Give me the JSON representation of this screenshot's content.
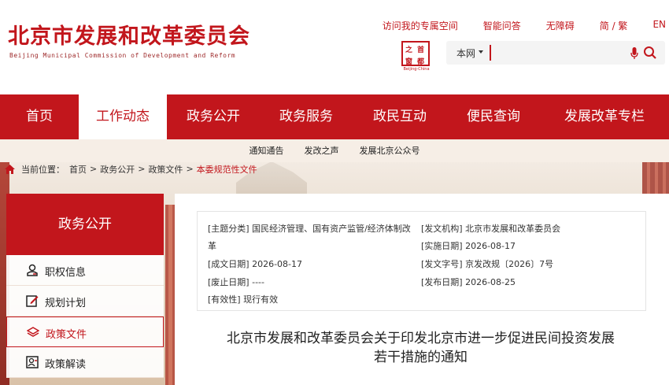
{
  "header": {
    "site_title": "北京市发展和改革委员会",
    "site_subtitle": "Beijing Municipal Commission of Development and Reform",
    "top_links": [
      "访问我的专属空间",
      "智能问答",
      "无障碍",
      "简 / 繁",
      "EN"
    ],
    "logo": {
      "chars": [
        "首",
        "都",
        "之",
        "窗"
      ],
      "caption": "Beijing-China"
    }
  },
  "search": {
    "scope": "本网",
    "value": "",
    "placeholder": ""
  },
  "nav": {
    "items": [
      "首页",
      "工作动态",
      "政务公开",
      "政务服务",
      "政民互动",
      "便民查询",
      "发展改革专栏"
    ],
    "active_index": 1
  },
  "subnav": {
    "items": [
      "通知通告",
      "发改之声",
      "发展北京公众号"
    ]
  },
  "breadcrumb": {
    "label": "当前位置：",
    "items": [
      "首页",
      "政务公开",
      "政策文件",
      "本委规范性文件"
    ],
    "sep": ">"
  },
  "sidebar": {
    "heading": "政务公开",
    "items": [
      {
        "label": "职权信息",
        "icon": "person-badge-icon"
      },
      {
        "label": "规划计划",
        "icon": "edit-document-icon"
      },
      {
        "label": "政策文件",
        "icon": "layers-icon"
      },
      {
        "label": "政策解读",
        "icon": "reader-icon"
      }
    ],
    "active_index": 2
  },
  "doc_meta": {
    "topic_label": "[主题分类]",
    "topic_value_1": "国民经济管理、国有资产监管/经济体制改",
    "topic_value_2": "革",
    "issuer_label": "[发文机构]",
    "issuer_value": "北京市发展和改革委员会",
    "effective_label": "[实施日期]",
    "effective_value": "2026-08-17",
    "created_label": "[成文日期]",
    "created_value": "2026-08-17",
    "docno_label": "[发文字号]",
    "docno_value": "京发改规〔2026〕7号",
    "repeal_label": "[废止日期]",
    "repeal_value": "----",
    "published_label": "[发布日期]",
    "published_value": "2026-08-25",
    "validity_label": "[有效性]",
    "validity_value": "现行有效"
  },
  "document": {
    "title_line1": "北京市发展和改革委员会关于印发北京市进一步促进民间投资发展",
    "title_line2": "若干措施的通知"
  },
  "colors": {
    "brand_red": "#c2161c",
    "subnav_bg": "#f6eee6"
  }
}
